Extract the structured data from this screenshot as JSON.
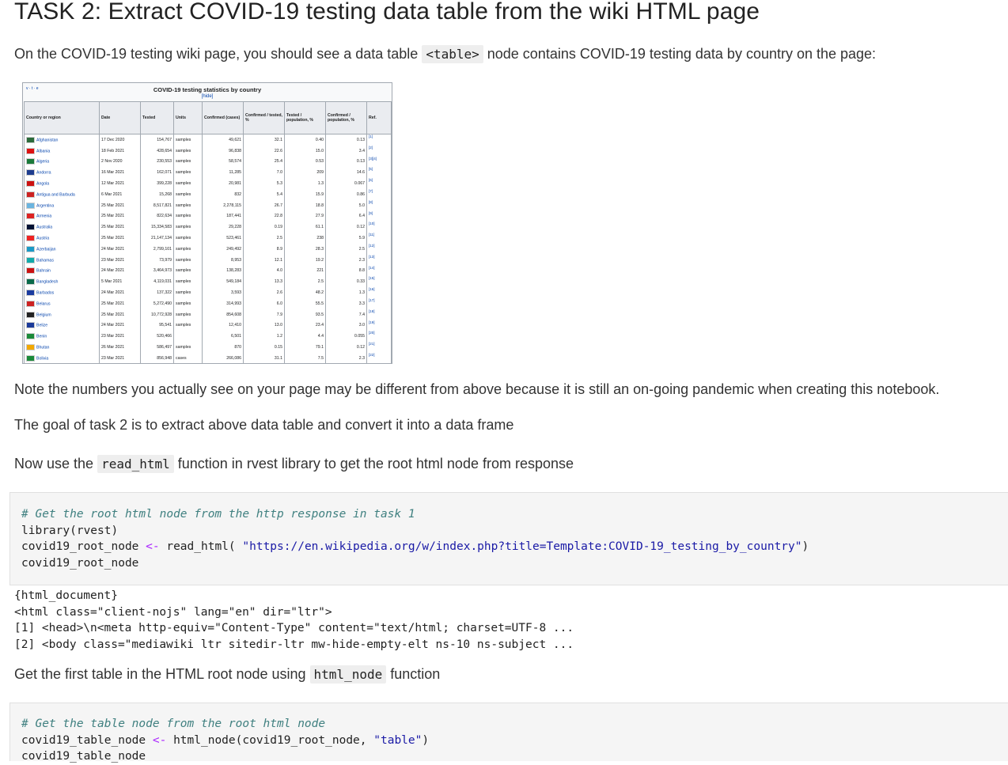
{
  "heading": "TASK 2: Extract COVID-19 testing data table from the wiki HTML page",
  "intro": {
    "before": "On the COVID-19 testing wiki page, you should see a data table ",
    "code": "<table>",
    "after": " node contains COVID-19 testing data by country on the page:"
  },
  "wiki_table": {
    "vte": "v · t · e",
    "caption": "COVID-19 testing statistics by country",
    "hide": "[hide]",
    "headers": [
      "Country or region",
      "Date",
      "Tested",
      "Units",
      "Confirmed (cases)",
      "Confirmed / tested, %",
      "Tested / population, %",
      "Confirmed / population, %",
      "Ref."
    ],
    "rows": [
      [
        "Afghanistan",
        "17 Dec 2020",
        "154,767",
        "samples",
        "49,621",
        "32.1",
        "0.40",
        "0.13",
        "[1]"
      ],
      [
        "Albania",
        "18 Feb 2021",
        "428,654",
        "samples",
        "96,838",
        "22.6",
        "15.0",
        "3.4",
        "[2]"
      ],
      [
        "Algeria",
        "2 Nov 2020",
        "230,553",
        "samples",
        "58,574",
        "25.4",
        "0.53",
        "0.13",
        "[3][4]"
      ],
      [
        "Andorra",
        "16 Mar 2021",
        "162,071",
        "samples",
        "11,285",
        "7.0",
        "209",
        "14.6",
        "[5]"
      ],
      [
        "Angola",
        "12 Mar 2021",
        "399,228",
        "samples",
        "20,981",
        "5.3",
        "1.3",
        "0.067",
        "[6]"
      ],
      [
        "Antigua and Barbuda",
        "6 Mar 2021",
        "15,268",
        "samples",
        "832",
        "5.4",
        "15.9",
        "0.86",
        "[7]"
      ],
      [
        "Argentina",
        "25 Mar 2021",
        "8,517,821",
        "samples",
        "2,278,115",
        "26.7",
        "18.8",
        "5.0",
        "[8]"
      ],
      [
        "Armenia",
        "25 Mar 2021",
        "822,634",
        "samples",
        "187,441",
        "22.8",
        "27.9",
        "6.4",
        "[9]"
      ],
      [
        "Australia",
        "25 Mar 2021",
        "15,334,583",
        "samples",
        "29,228",
        "0.19",
        "61.1",
        "0.12",
        "[10]"
      ],
      [
        "Austria",
        "25 Mar 2021",
        "21,147,134",
        "samples",
        "523,461",
        "2.5",
        "238",
        "5.9",
        "[11]"
      ],
      [
        "Azerbaijan",
        "24 Mar 2021",
        "2,799,101",
        "samples",
        "249,492",
        "8.9",
        "28.3",
        "2.5",
        "[12]"
      ],
      [
        "Bahamas",
        "23 Mar 2021",
        "73,979",
        "samples",
        "8,953",
        "12.1",
        "19.2",
        "2.3",
        "[13]"
      ],
      [
        "Bahrain",
        "24 Mar 2021",
        "3,464,973",
        "samples",
        "138,283",
        "4.0",
        "221",
        "8.8",
        "[14]"
      ],
      [
        "Bangladesh",
        "5 Mar 2021",
        "4,119,031",
        "samples",
        "549,184",
        "13.3",
        "2.5",
        "0.33",
        "[15]"
      ],
      [
        "Barbados",
        "24 Mar 2021",
        "137,322",
        "samples",
        "3,593",
        "2.6",
        "48.2",
        "1.3",
        "[16]"
      ],
      [
        "Belarus",
        "25 Mar 2021",
        "5,272,490",
        "samples",
        "314,993",
        "6.0",
        "55.5",
        "3.3",
        "[17]"
      ],
      [
        "Belgium",
        "25 Mar 2021",
        "10,772,928",
        "samples",
        "854,608",
        "7.9",
        "93.5",
        "7.4",
        "[18]"
      ],
      [
        "Belize",
        "24 Mar 2021",
        "95,541",
        "samples",
        "12,410",
        "13.0",
        "23.4",
        "3.0",
        "[19]"
      ],
      [
        "Benin",
        "23 Mar 2021",
        "520,466",
        "",
        "6,501",
        "1.2",
        "4.4",
        "0.055",
        "[20]"
      ],
      [
        "Bhutan",
        "26 Mar 2021",
        "586,497",
        "samples",
        "870",
        "0.15",
        "79.1",
        "0.12",
        "[21]"
      ],
      [
        "Bolivia",
        "23 Mar 2021",
        "856,948",
        "cases",
        "266,086",
        "31.1",
        "7.5",
        "2.3",
        "[22]"
      ]
    ],
    "flag_colors": [
      "#2b6b3a",
      "#d11",
      "#1a7a3a",
      "#1d3c8f",
      "#c11",
      "#c22",
      "#6ab4e0",
      "#d22",
      "#013",
      "#e22",
      "#1a9ac6",
      "#1aa",
      "#c11",
      "#0a6a4a",
      "#1a3ba0",
      "#c22",
      "#222",
      "#1a3a9a",
      "#1a8a3a",
      "#f2a800",
      "#1a8a3a"
    ]
  },
  "note": "Note the numbers you actually see on your page may be different from above because it is still an on-going pandemic when creating this notebook.",
  "goal": "The goal of task 2 is to extract above data table and convert it into a data frame",
  "read_html_text": {
    "before": "Now use the ",
    "code": "read_html",
    "after": " function in rvest library to get the root html node from response"
  },
  "code_cell_1": {
    "comment": "# Get the root html node from the http response in task 1",
    "line2": "library(rvest)",
    "line3_a": "covid19_root_node ",
    "line3_op": "<-",
    "line3_b": " read_html( ",
    "line3_str": "\"https://en.wikipedia.org/w/index.php?title=Template:COVID-19_testing_by_country\"",
    "line3_c": ")",
    "line4": "covid19_root_node"
  },
  "output_1": [
    "{html_document}",
    "<html class=\"client-nojs\" lang=\"en\" dir=\"ltr\">",
    "[1] <head>\\n<meta http-equiv=\"Content-Type\" content=\"text/html; charset=UTF-8 ...",
    "[2] <body class=\"mediawiki ltr sitedir-ltr mw-hide-empty-elt ns-10 ns-subject ..."
  ],
  "html_node_text": {
    "before": "Get the first table in the HTML root node using ",
    "code": "html_node",
    "after": " function"
  },
  "code_cell_2": {
    "comment": "# Get the table node from the root html node",
    "line2_a": "covid19_table_node ",
    "line2_op": "<-",
    "line2_b": " html_node(covid19_root_node, ",
    "line2_str": "\"table\"",
    "line2_c": ")",
    "line3": "covid19_table_node"
  }
}
